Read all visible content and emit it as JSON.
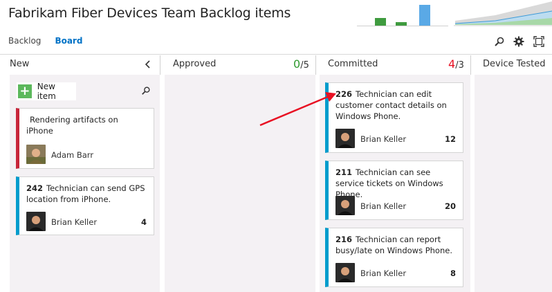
{
  "header": {
    "title": "Fabrikam Fiber Devices Team Backlog items",
    "mini_bar_levels": [
      0.34,
      0.16,
      0.94
    ],
    "mini_bar_colors": [
      "#3f9b3f",
      "#3f9b3f",
      "#5aa9e6"
    ]
  },
  "nav": {
    "tabs": [
      {
        "label": "Backlog"
      },
      {
        "label": "Board"
      }
    ],
    "active_tab": "Board"
  },
  "toolbar": {
    "icons": [
      "search-icon",
      "gear-icon",
      "fullscreen-icon"
    ]
  },
  "columns": [
    {
      "name": "New",
      "count": "",
      "limit": ""
    },
    {
      "name": "Approved",
      "count": "0",
      "limit": "/5",
      "count_color": "#2f9a2f"
    },
    {
      "name": "Committed",
      "count": "4",
      "limit": "/3",
      "count_color": "#e81123"
    },
    {
      "name": "Device Tested",
      "count": "",
      "limit": ""
    }
  ],
  "new_item": {
    "label": "New item"
  },
  "cards": [
    {
      "id": "",
      "title": "Rendering artifacts on iPhone",
      "assignee": "Adam Barr",
      "effort": "",
      "color": "#c7253a"
    },
    {
      "id": "242",
      "title": "Technician can send GPS location from iPhone.",
      "assignee": "Brian Keller",
      "effort": "4",
      "color": "#009ccc"
    },
    {
      "id": "226",
      "title": "Technician can edit customer contact details on Windows Phone.",
      "assignee": "Brian Keller",
      "effort": "12",
      "color": "#009ccc"
    },
    {
      "id": "211",
      "title": "Technician can see service tickets on Windows Phone.",
      "assignee": "Brian Keller",
      "effort": "20",
      "color": "#009ccc"
    },
    {
      "id": "216",
      "title": "Technician can report busy/late on Windows Phone.",
      "assignee": "Brian Keller",
      "effort": "8",
      "color": "#009ccc"
    }
  ],
  "annotation": {
    "arrow_color": "#e81123"
  }
}
